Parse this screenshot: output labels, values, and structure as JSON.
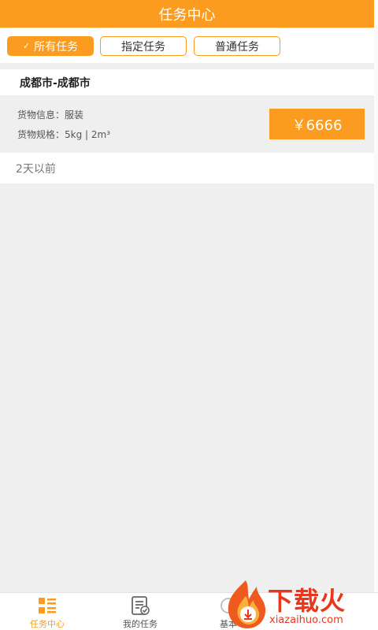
{
  "header": {
    "title": "任务中心"
  },
  "filters": {
    "all": "所有任务",
    "assigned": "指定任务",
    "normal": "普通任务",
    "check_mark": "✓"
  },
  "task": {
    "route": "成都市-成都市",
    "cargo_info": "货物信息：服装",
    "cargo_spec": "货物规格：5kg | 2m³",
    "price": "￥6666",
    "time": "2天以前"
  },
  "tabbar": {
    "tab1": "任务中心",
    "tab2": "我的任务",
    "tab3": "基本"
  },
  "watermark": {
    "brand": "下载火",
    "url": "xiazaihuo.com"
  },
  "colors": {
    "accent": "#fb9b1f",
    "watermark": "#e8371c"
  }
}
